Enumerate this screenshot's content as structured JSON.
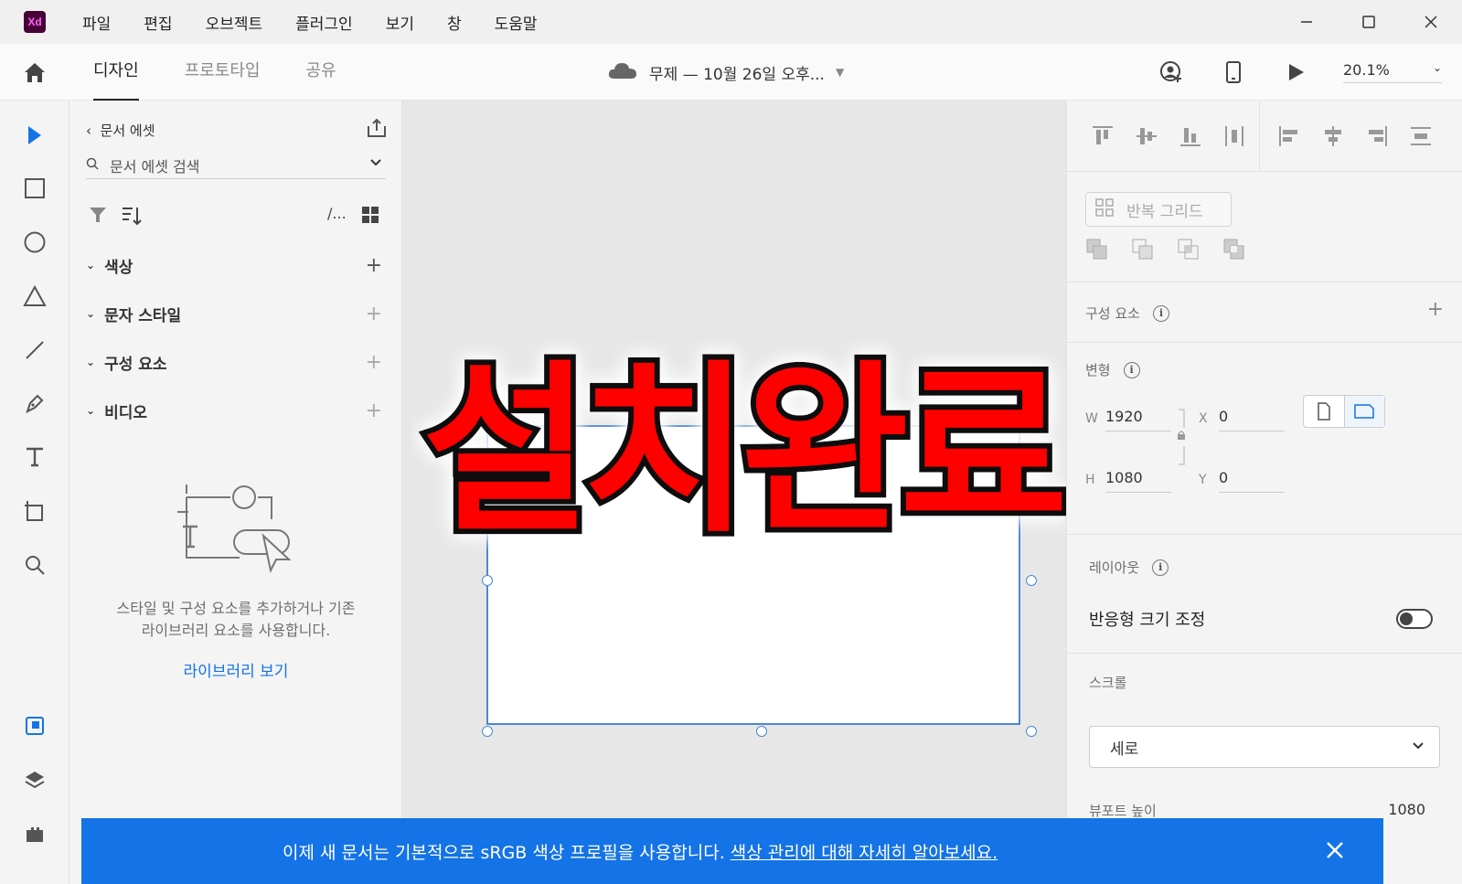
{
  "app": {
    "logo": "Xd"
  },
  "menu": [
    "파일",
    "편집",
    "오브젝트",
    "플러그인",
    "보기",
    "창",
    "도움말"
  ],
  "window_controls": [
    "minimize-icon",
    "maximize-icon",
    "close-icon"
  ],
  "tabs": [
    {
      "label": "디자인",
      "active": true
    },
    {
      "label": "프로토타입",
      "active": false
    },
    {
      "label": "공유",
      "active": false
    }
  ],
  "document": {
    "title": "무제 — 10월 26일 오후..."
  },
  "zoom": "20.1%",
  "assets": {
    "back_label": "문서 에셋",
    "search_placeholder": "문서 에셋 검색",
    "sections": [
      {
        "label": "색상",
        "plus_dim": false
      },
      {
        "label": "문자 스타일",
        "plus_dim": true
      },
      {
        "label": "구성 요소",
        "plus_dim": true
      },
      {
        "label": "비디오",
        "plus_dim": true
      }
    ],
    "empty_text_1": "스타일 및 구성 요소를 추가하거나 기존",
    "empty_text_2": "라이브러리 요소를 사용합니다.",
    "library_link": "라이브러리 보기"
  },
  "overlay_title": "설치완료",
  "props": {
    "repeat_grid": "반복 그리드",
    "components_label": "구성 요소",
    "transform_label": "변형",
    "w_label": "W",
    "w": "1920",
    "h_label": "H",
    "h": "1080",
    "x_label": "X",
    "x": "0",
    "y_label": "Y",
    "y": "0",
    "layout_label": "레이아웃",
    "responsive_label": "반응형 크기 조정",
    "responsive_on": false,
    "scroll_label": "스크롤",
    "scroll_value": "세로",
    "viewport_label": "뷰포트 높이",
    "viewport_value": "1080"
  },
  "toast": {
    "text": "이제 새 문서는 기본적으로 sRGB 색상 프로필을 사용합니다.",
    "link": "색상 관리에 대해 자세히 알아보세요."
  },
  "colors": {
    "accent": "#1473e6",
    "overlay_red": "#ff0000",
    "xd_bg": "#470137",
    "xd_fg": "#ff61f6"
  }
}
